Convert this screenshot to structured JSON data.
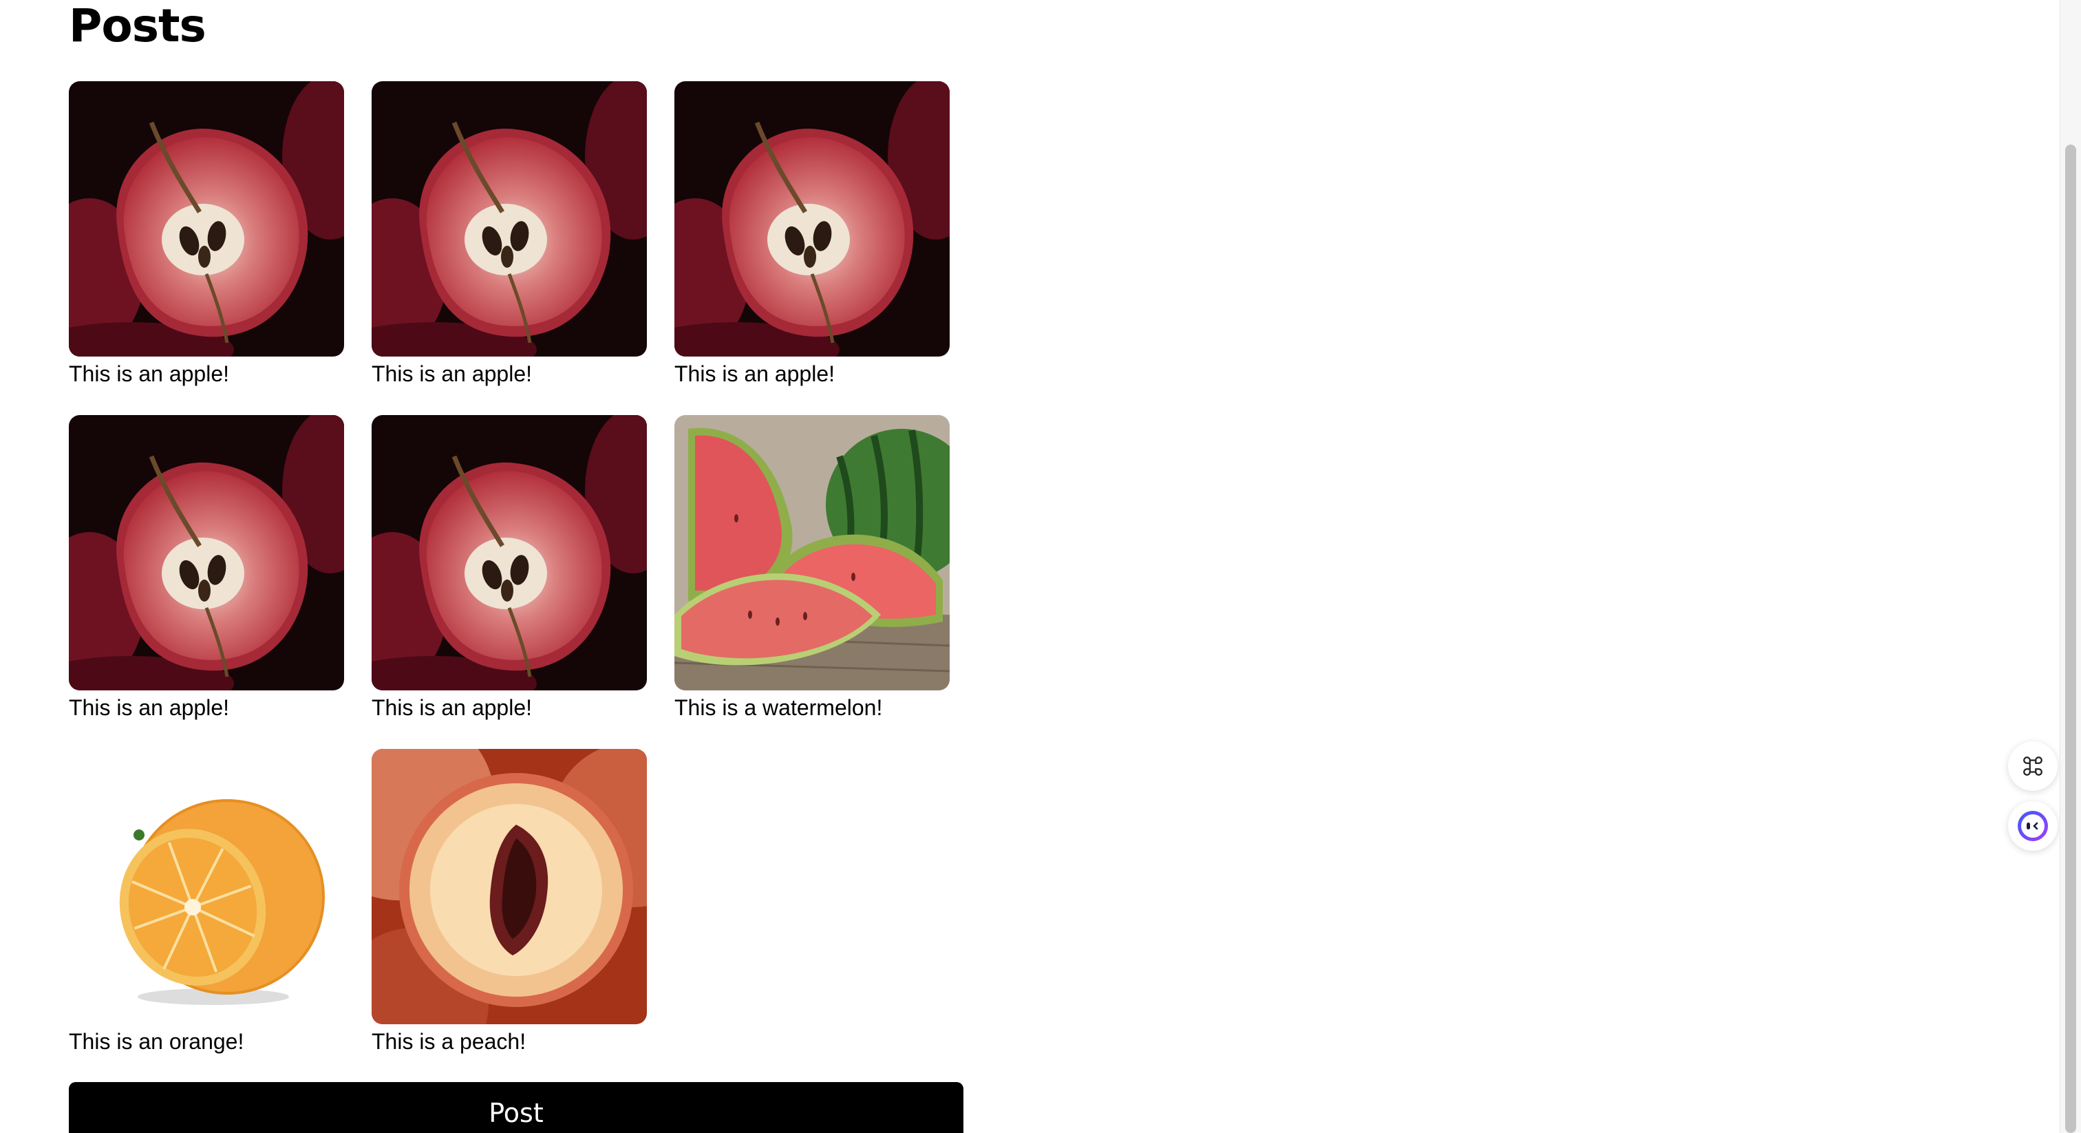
{
  "page": {
    "title": "Posts"
  },
  "posts": [
    {
      "caption": "This is an apple!",
      "image": "apple"
    },
    {
      "caption": "This is an apple!",
      "image": "apple"
    },
    {
      "caption": "This is an apple!",
      "image": "apple"
    },
    {
      "caption": "This is an apple!",
      "image": "apple"
    },
    {
      "caption": "This is an apple!",
      "image": "apple"
    },
    {
      "caption": "This is a watermelon!",
      "image": "watermelon"
    },
    {
      "caption": "This is an orange!",
      "image": "orange"
    },
    {
      "caption": "This is a peach!",
      "image": "peach"
    }
  ],
  "actions": {
    "post_label": "Post"
  },
  "floating": {
    "top_icon": "command-key-icon",
    "bottom_icon": "assistant-face-icon"
  },
  "colors": {
    "button_bg": "#000000",
    "button_text": "#ffffff",
    "assistant_gradient": [
      "#3b5bfd",
      "#a23df5"
    ]
  }
}
